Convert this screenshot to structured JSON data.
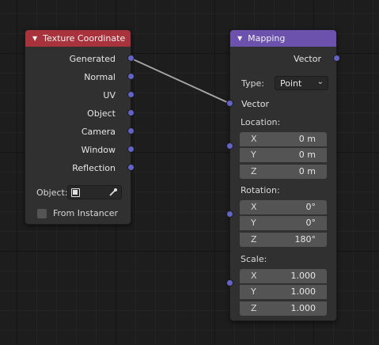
{
  "colors": {
    "texture_coordinate_header": "#a8333d",
    "mapping_header": "#6c52ad",
    "socket_vector": "#6363c7",
    "link": "#9a9a9a"
  },
  "texture_coordinate": {
    "title": "Texture Coordinate",
    "outputs": [
      "Generated",
      "Normal",
      "UV",
      "Object",
      "Camera",
      "Window",
      "Reflection"
    ],
    "object_label": "Object:",
    "object_value": "",
    "object_icon": "object-cube-icon",
    "eyedropper_icon": "eyedropper-icon",
    "from_instancer_label": "From Instancer",
    "from_instancer_checked": false
  },
  "mapping": {
    "title": "Mapping",
    "output_label": "Vector",
    "type_label": "Type:",
    "type_value": "Point",
    "vector_input_label": "Vector",
    "location": {
      "label": "Location:",
      "fields": [
        {
          "axis": "X",
          "value": "0 m"
        },
        {
          "axis": "Y",
          "value": "0 m"
        },
        {
          "axis": "Z",
          "value": "0 m"
        }
      ]
    },
    "rotation": {
      "label": "Rotation:",
      "fields": [
        {
          "axis": "X",
          "value": "0°"
        },
        {
          "axis": "Y",
          "value": "0°"
        },
        {
          "axis": "Z",
          "value": "180°"
        }
      ]
    },
    "scale": {
      "label": "Scale:",
      "fields": [
        {
          "axis": "X",
          "value": "1.000"
        },
        {
          "axis": "Y",
          "value": "1.000"
        },
        {
          "axis": "Z",
          "value": "1.000"
        }
      ]
    }
  }
}
